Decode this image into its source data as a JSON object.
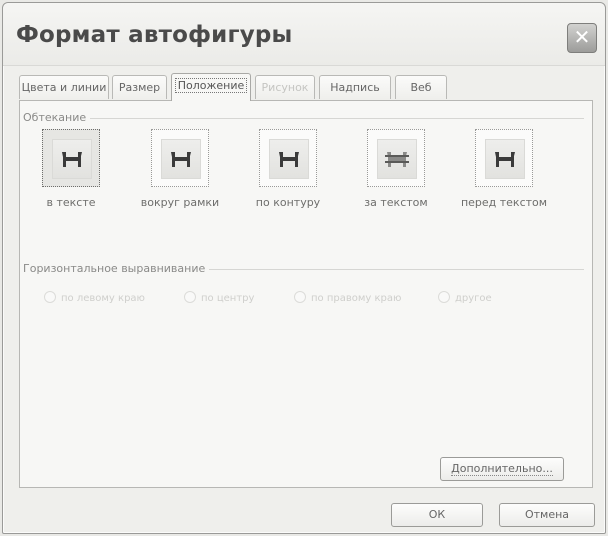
{
  "window": {
    "title": "Формат автофигуры"
  },
  "tabs": [
    {
      "label": "Цвета и линии",
      "state": "normal"
    },
    {
      "label": "Размер",
      "state": "normal"
    },
    {
      "label": "Положение",
      "state": "active"
    },
    {
      "label": "Рисунок",
      "state": "disabled"
    },
    {
      "label": "Надпись",
      "state": "normal"
    },
    {
      "label": "Веб",
      "state": "normal"
    }
  ],
  "wrapping": {
    "group_label": "Обтекание",
    "options": [
      {
        "label": "в тексте",
        "selected": true
      },
      {
        "label": "вокруг рамки",
        "selected": false
      },
      {
        "label": "по контуру",
        "selected": false
      },
      {
        "label": "за текстом",
        "selected": false
      },
      {
        "label": "перед текстом",
        "selected": false
      }
    ]
  },
  "horizontal_alignment": {
    "group_label": "Горизонтальное выравнивание",
    "options": [
      "по левому краю",
      "по центру",
      "по правому краю",
      "другое"
    ],
    "enabled": false
  },
  "buttons": {
    "advanced": "Дополнительно...",
    "ok": "ОК",
    "cancel": "Отмена"
  },
  "colors": {
    "icon": "#3a3a3a",
    "disabled_text": "#cfcfcc"
  }
}
